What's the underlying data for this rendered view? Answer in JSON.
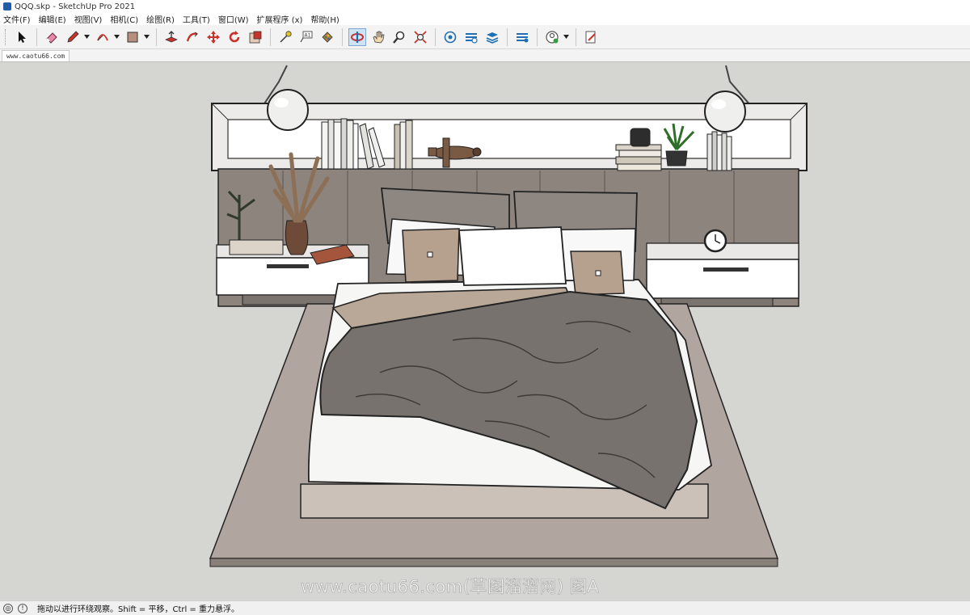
{
  "window": {
    "title": "QQQ.skp - SketchUp Pro 2021",
    "logo_icon": "sketchup-logo-icon"
  },
  "menu": [
    "文件(F)",
    "编辑(E)",
    "视图(V)",
    "相机(C)",
    "绘图(R)",
    "工具(T)",
    "窗口(W)",
    "扩展程序 (x)",
    "帮助(H)"
  ],
  "toolbar": {
    "tools": [
      "select",
      "eraser",
      "line",
      "arc",
      "shape",
      "push-pull",
      "move",
      "rotate",
      "scale",
      "offset",
      "tape-measure",
      "text",
      "paint-bucket",
      "orbit",
      "pan",
      "zoom",
      "zoom-extents",
      "warehouse",
      "extension-warehouse",
      "layout",
      "send-to-layout",
      "profile",
      "report"
    ],
    "active_tool": "orbit"
  },
  "scene_tab": {
    "label": "www.caotu66.com"
  },
  "watermark": "www.caotu66.com(草图溜溜网) 图A",
  "status": {
    "message": "拖动以进行环绕观察。Shift = 平移，Ctrl = 重力悬浮。"
  },
  "colors": {
    "viewport_bg": "#d5d5d2",
    "active_tool_bg": "#cfe3f7",
    "accent_red": "#c8322b",
    "accent_blue": "#1e6fb3"
  }
}
